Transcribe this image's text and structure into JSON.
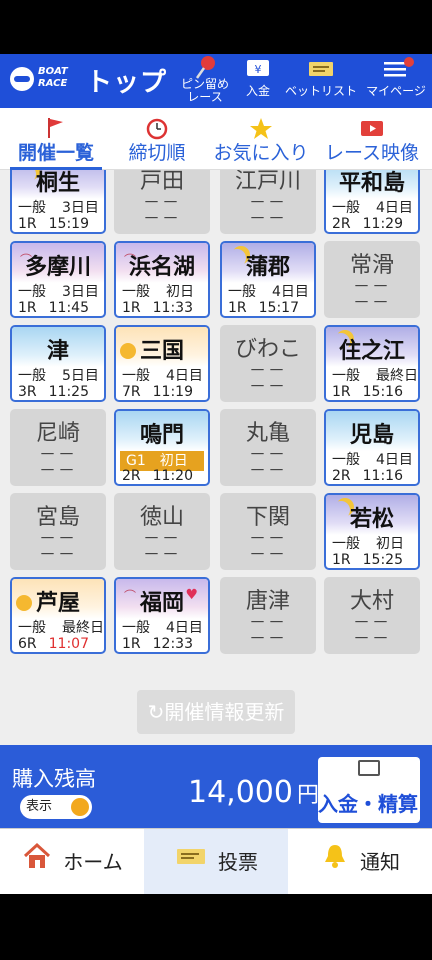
{
  "header": {
    "logo_text": "BOAT\nRACE",
    "title": "トップ",
    "items": [
      {
        "label": "ピン留め\nレース",
        "icon": "pin-icon"
      },
      {
        "label": "入金",
        "icon": "deposit-icon"
      },
      {
        "label": "ベットリスト",
        "icon": "ticket-icon"
      },
      {
        "label": "マイページ",
        "icon": "menu-icon"
      }
    ]
  },
  "tabs": [
    {
      "label": "開催一覧",
      "icon": "flag-icon",
      "active": true
    },
    {
      "label": "締切順",
      "icon": "clock-icon"
    },
    {
      "label": "お気に入り",
      "icon": "star-icon"
    },
    {
      "label": "レース映像",
      "icon": "video-icon"
    }
  ],
  "venues": [
    {
      "name": "桐生",
      "grade": "一般",
      "day": "3日目",
      "race": "1R",
      "time": "15:19",
      "theme": "night"
    },
    {
      "name": "戸田",
      "off": true
    },
    {
      "name": "江戸川",
      "off": true
    },
    {
      "name": "平和島",
      "grade": "一般",
      "day": "4日目",
      "race": "2R",
      "time": "11:29",
      "theme": "day"
    },
    {
      "name": "多摩川",
      "grade": "一般",
      "day": "3日目",
      "race": "1R",
      "time": "11:45",
      "theme": "eve"
    },
    {
      "name": "浜名湖",
      "grade": "一般",
      "day": "初日",
      "race": "1R",
      "time": "11:33",
      "theme": "eve"
    },
    {
      "name": "蒲郡",
      "grade": "一般",
      "day": "4日目",
      "race": "1R",
      "time": "15:17",
      "theme": "night"
    },
    {
      "name": "常滑",
      "off": true
    },
    {
      "name": "津",
      "grade": "一般",
      "day": "5日目",
      "race": "3R",
      "time": "11:25",
      "theme": "day"
    },
    {
      "name": "三国",
      "grade": "一般",
      "day": "4日目",
      "race": "7R",
      "time": "11:19",
      "theme": "morn"
    },
    {
      "name": "びわこ",
      "off": true
    },
    {
      "name": "住之江",
      "grade": "一般",
      "day": "最終日",
      "race": "1R",
      "time": "15:16",
      "theme": "night"
    },
    {
      "name": "尼崎",
      "off": true
    },
    {
      "name": "鳴門",
      "grade": "G1",
      "day": "初日",
      "race": "2R",
      "time": "11:20",
      "theme": "day",
      "g1": true
    },
    {
      "name": "丸亀",
      "off": true
    },
    {
      "name": "児島",
      "grade": "一般",
      "day": "4日目",
      "race": "2R",
      "time": "11:16",
      "theme": "day"
    },
    {
      "name": "宮島",
      "off": true
    },
    {
      "name": "徳山",
      "off": true
    },
    {
      "name": "下関",
      "off": true
    },
    {
      "name": "若松",
      "grade": "一般",
      "day": "初日",
      "race": "1R",
      "time": "15:25",
      "theme": "night"
    },
    {
      "name": "芦屋",
      "grade": "一般",
      "day": "最終日",
      "race": "6R",
      "time": "11:07",
      "theme": "morn",
      "time_red": true
    },
    {
      "name": "福岡",
      "grade": "一般",
      "day": "4日目",
      "race": "1R",
      "time": "12:33",
      "theme": "eve",
      "heart": true
    },
    {
      "name": "唐津",
      "off": true
    },
    {
      "name": "大村",
      "off": true
    }
  ],
  "off_text": "－－\n－－",
  "refresh_label": "開催情報更新",
  "balance": {
    "label": "購入残高",
    "toggle_label": "表示",
    "amount": "14,000",
    "unit": "円",
    "deposit_label": "入金・精算"
  },
  "bottom_nav": [
    {
      "label": "ホーム",
      "icon": "home-icon"
    },
    {
      "label": "投票",
      "icon": "ticket-icon",
      "active": true
    },
    {
      "label": "通知",
      "icon": "bell-icon"
    }
  ],
  "colors": {
    "brand_blue": "#1f4fd8",
    "g1_orange": "#e6a21f",
    "deadline_red": "#e03030"
  }
}
